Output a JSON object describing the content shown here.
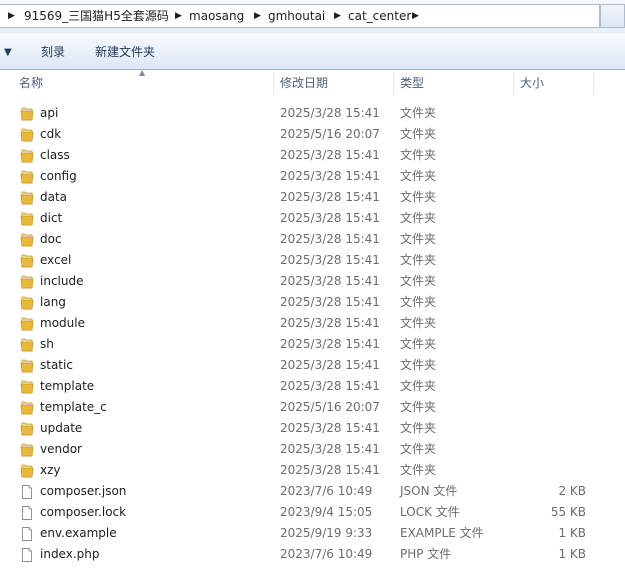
{
  "breadcrumb": {
    "items": [
      "91569_三国猫H5全套源码",
      "maosang",
      "gmhoutai",
      "cat_center"
    ]
  },
  "toolbar": {
    "burn_label": "刻录",
    "new_folder_label": "新建文件夹"
  },
  "columns": {
    "name": "名称",
    "date": "修改日期",
    "type": "类型",
    "size": "大小"
  },
  "files": [
    {
      "name": "api",
      "date": "2025/3/28 15:41",
      "type": "文件夹",
      "size": "",
      "kind": "folder"
    },
    {
      "name": "cdk",
      "date": "2025/5/16 20:07",
      "type": "文件夹",
      "size": "",
      "kind": "folder"
    },
    {
      "name": "class",
      "date": "2025/3/28 15:41",
      "type": "文件夹",
      "size": "",
      "kind": "folder"
    },
    {
      "name": "config",
      "date": "2025/3/28 15:41",
      "type": "文件夹",
      "size": "",
      "kind": "folder"
    },
    {
      "name": "data",
      "date": "2025/3/28 15:41",
      "type": "文件夹",
      "size": "",
      "kind": "folder"
    },
    {
      "name": "dict",
      "date": "2025/3/28 15:41",
      "type": "文件夹",
      "size": "",
      "kind": "folder"
    },
    {
      "name": "doc",
      "date": "2025/3/28 15:41",
      "type": "文件夹",
      "size": "",
      "kind": "folder"
    },
    {
      "name": "excel",
      "date": "2025/3/28 15:41",
      "type": "文件夹",
      "size": "",
      "kind": "folder"
    },
    {
      "name": "include",
      "date": "2025/3/28 15:41",
      "type": "文件夹",
      "size": "",
      "kind": "folder"
    },
    {
      "name": "lang",
      "date": "2025/3/28 15:41",
      "type": "文件夹",
      "size": "",
      "kind": "folder"
    },
    {
      "name": "module",
      "date": "2025/3/28 15:41",
      "type": "文件夹",
      "size": "",
      "kind": "folder"
    },
    {
      "name": "sh",
      "date": "2025/3/28 15:41",
      "type": "文件夹",
      "size": "",
      "kind": "folder"
    },
    {
      "name": "static",
      "date": "2025/3/28 15:41",
      "type": "文件夹",
      "size": "",
      "kind": "folder"
    },
    {
      "name": "template",
      "date": "2025/3/28 15:41",
      "type": "文件夹",
      "size": "",
      "kind": "folder"
    },
    {
      "name": "template_c",
      "date": "2025/5/16 20:07",
      "type": "文件夹",
      "size": "",
      "kind": "folder"
    },
    {
      "name": "update",
      "date": "2025/3/28 15:41",
      "type": "文件夹",
      "size": "",
      "kind": "folder"
    },
    {
      "name": "vendor",
      "date": "2025/3/28 15:41",
      "type": "文件夹",
      "size": "",
      "kind": "folder"
    },
    {
      "name": "xzy",
      "date": "2025/3/28 15:41",
      "type": "文件夹",
      "size": "",
      "kind": "folder"
    },
    {
      "name": "composer.json",
      "date": "2023/7/6 10:49",
      "type": "JSON 文件",
      "size": "2 KB",
      "kind": "file"
    },
    {
      "name": "composer.lock",
      "date": "2023/9/4 15:05",
      "type": "LOCK 文件",
      "size": "55 KB",
      "kind": "file"
    },
    {
      "name": "env.example",
      "date": "2025/9/19 9:33",
      "type": "EXAMPLE 文件",
      "size": "1 KB",
      "kind": "file"
    },
    {
      "name": "index.php",
      "date": "2023/7/6 10:49",
      "type": "PHP 文件",
      "size": "1 KB",
      "kind": "file"
    }
  ],
  "colors": {
    "folder": "#e8b93a",
    "toolbar_text": "#1e395b",
    "header_text": "#4c607a",
    "meta_text": "#6d6d6d"
  }
}
